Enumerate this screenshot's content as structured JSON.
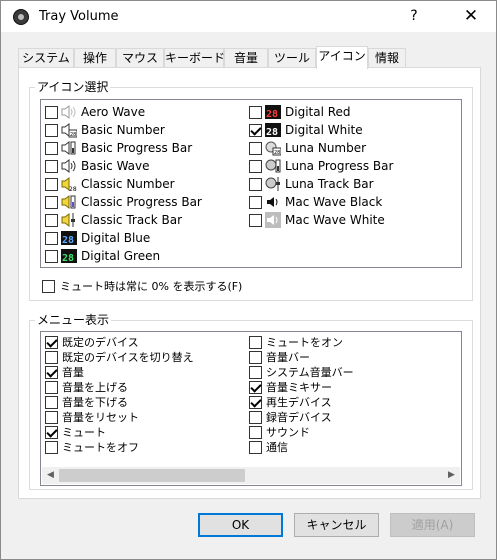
{
  "window": {
    "title": "Tray Volume",
    "help_glyph": "?",
    "close_glyph": "✕"
  },
  "tabs": [
    {
      "label": "システム"
    },
    {
      "label": "操作"
    },
    {
      "label": "マウス"
    },
    {
      "label": "キーボード"
    },
    {
      "label": "音量"
    },
    {
      "label": "ツール"
    },
    {
      "label": "アイコン",
      "active": true
    },
    {
      "label": "情報"
    }
  ],
  "icon_group": {
    "legend": "アイコン選択",
    "left_items": [
      {
        "label": "Aero Wave",
        "checked": false,
        "icon": "speaker-outline-icon"
      },
      {
        "label": "Basic Number",
        "checked": false,
        "icon": "speaker-number-icon"
      },
      {
        "label": "Basic Progress Bar",
        "checked": false,
        "icon": "speaker-bar-icon"
      },
      {
        "label": "Basic Wave",
        "checked": false,
        "icon": "speaker-wave-icon"
      },
      {
        "label": "Classic Number",
        "checked": false,
        "icon": "classic-number-icon"
      },
      {
        "label": "Classic Progress Bar",
        "checked": false,
        "icon": "classic-bar-icon"
      },
      {
        "label": "Classic Track Bar",
        "checked": false,
        "icon": "classic-track-icon"
      },
      {
        "label": "Digital Blue",
        "checked": false,
        "icon": "digital-blue-icon",
        "icon_text": "28"
      },
      {
        "label": "Digital Green",
        "checked": false,
        "icon": "digital-green-icon",
        "icon_text": "28"
      }
    ],
    "right_items": [
      {
        "label": "Digital Red",
        "checked": false,
        "icon": "digital-red-icon",
        "icon_text": "28"
      },
      {
        "label": "Digital White",
        "checked": true,
        "icon": "digital-white-icon",
        "icon_text": "28"
      },
      {
        "label": "Luna Number",
        "checked": false,
        "icon": "luna-number-icon"
      },
      {
        "label": "Luna Progress Bar",
        "checked": false,
        "icon": "luna-bar-icon"
      },
      {
        "label": "Luna Track Bar",
        "checked": false,
        "icon": "luna-track-icon"
      },
      {
        "label": "Mac Wave Black",
        "checked": false,
        "icon": "mac-black-icon"
      },
      {
        "label": "Mac Wave White",
        "checked": false,
        "icon": "mac-white-icon"
      }
    ],
    "mute_option": {
      "label": "ミュート時は常に 0% を表示する(F)",
      "checked": false
    }
  },
  "menu_group": {
    "legend": "メニュー表示",
    "left_items": [
      {
        "label": "既定のデバイス",
        "checked": true
      },
      {
        "label": "既定のデバイスを切り替え",
        "checked": false
      },
      {
        "label": "音量",
        "checked": true
      },
      {
        "label": "音量を上げる",
        "checked": false
      },
      {
        "label": "音量を下げる",
        "checked": false
      },
      {
        "label": "音量をリセット",
        "checked": false
      },
      {
        "label": "ミュート",
        "checked": true
      },
      {
        "label": "ミュートをオフ",
        "checked": false
      }
    ],
    "right_items": [
      {
        "label": "ミュートをオン",
        "checked": false
      },
      {
        "label": "音量バー",
        "checked": false
      },
      {
        "label": "システム音量バー",
        "checked": false
      },
      {
        "label": "音量ミキサー",
        "checked": true
      },
      {
        "label": "再生デバイス",
        "checked": true
      },
      {
        "label": "録音デバイス",
        "checked": false
      },
      {
        "label": "サウンド",
        "checked": false
      },
      {
        "label": "通信",
        "checked": false
      }
    ],
    "scroll_left": "◀",
    "scroll_right": "▶"
  },
  "buttons": {
    "ok": "OK",
    "cancel": "キャンセル",
    "apply": "適用(A)"
  }
}
